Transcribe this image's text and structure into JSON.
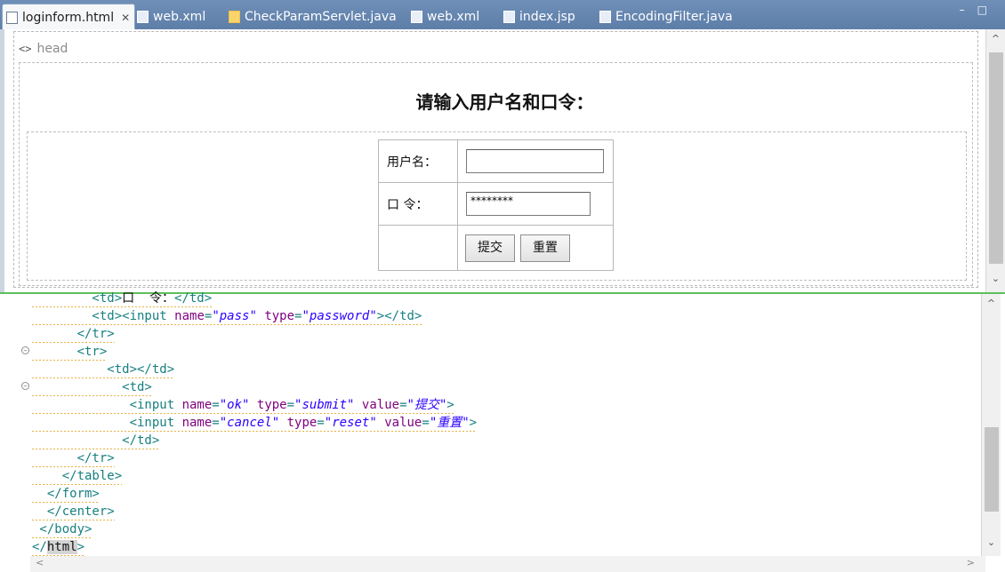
{
  "tabs": [
    {
      "label": "loginform.html",
      "icon": "html-file-icon",
      "active": true
    },
    {
      "label": "web.xml",
      "icon": "xml-file-icon"
    },
    {
      "label": "CheckParamServlet.java",
      "icon": "java-file-icon"
    },
    {
      "label": "web.xml",
      "icon": "xml-file-icon"
    },
    {
      "label": "index.jsp",
      "icon": "jsp-file-icon"
    },
    {
      "label": "EncodingFilter.java",
      "icon": "java-file-icon"
    }
  ],
  "tab_close_glyph": "✕",
  "design": {
    "head_label": "head",
    "prompt": "请输入用户名和口令：",
    "username_label": "用户名：",
    "username_value": "",
    "password_label": "口 令：",
    "password_value": "********",
    "submit_label": "提交",
    "reset_label": "重置"
  },
  "source_lines": [
    [
      [
        "t",
        "        <td>"
      ],
      [
        "",
        "口  令："
      ],
      [
        "t",
        "</td>"
      ]
    ],
    [
      [
        "t",
        "        <td><input "
      ],
      [
        "a",
        "name"
      ],
      [
        "t",
        "="
      ],
      [
        "v",
        "\"pass\""
      ],
      [
        "t",
        " "
      ],
      [
        "a",
        "type"
      ],
      [
        "t",
        "="
      ],
      [
        "v",
        "\"password\""
      ],
      [
        "t",
        "></td>"
      ]
    ],
    [
      [
        "t",
        "      </tr>"
      ]
    ],
    [
      [
        "t",
        "      <tr>"
      ]
    ],
    [
      [
        "t",
        "          <td></td>"
      ]
    ],
    [
      [
        "t",
        "            <td>"
      ]
    ],
    [
      [
        "t",
        "             <input "
      ],
      [
        "a",
        "name"
      ],
      [
        "t",
        "="
      ],
      [
        "v",
        "\"ok\""
      ],
      [
        "t",
        " "
      ],
      [
        "a",
        "type"
      ],
      [
        "t",
        "="
      ],
      [
        "v",
        "\"submit\""
      ],
      [
        "t",
        " "
      ],
      [
        "a",
        "value"
      ],
      [
        "t",
        "="
      ],
      [
        "v",
        "\"提交\""
      ],
      [
        "t",
        ">"
      ]
    ],
    [
      [
        "t",
        "             <input "
      ],
      [
        "a",
        "name"
      ],
      [
        "t",
        "="
      ],
      [
        "v",
        "\"cancel\""
      ],
      [
        "t",
        " "
      ],
      [
        "a",
        "type"
      ],
      [
        "t",
        "="
      ],
      [
        "v",
        "\"reset\""
      ],
      [
        "t",
        " "
      ],
      [
        "a",
        "value"
      ],
      [
        "t",
        "="
      ],
      [
        "v",
        "\"重置\""
      ],
      [
        "t",
        ">"
      ]
    ],
    [
      [
        "t",
        "            </td>"
      ]
    ],
    [
      [
        "t",
        "      </tr>"
      ]
    ],
    [
      [
        "t",
        "    </table>"
      ]
    ],
    [
      [
        "t",
        "  </form>"
      ]
    ],
    [
      [
        "t",
        "  </center>"
      ]
    ],
    [
      [
        "t",
        " </body>"
      ]
    ],
    [
      [
        "t",
        "</"
      ],
      [
        "hl",
        "html"
      ],
      [
        "t",
        ">"
      ]
    ]
  ],
  "colors": {
    "tag": "#177f80",
    "attr": "#7f007f",
    "value": "#2a00ff",
    "pane_divider": "#5cbf5c"
  }
}
